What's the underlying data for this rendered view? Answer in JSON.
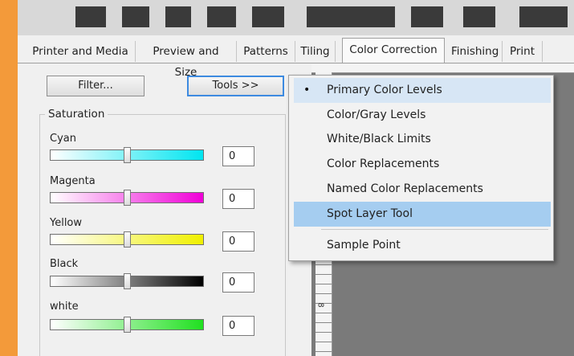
{
  "tabs": [
    {
      "label": "Printer and Media"
    },
    {
      "label": "Preview and Size"
    },
    {
      "label": "Patterns"
    },
    {
      "label": "Tiling"
    },
    {
      "label": "Color Correction"
    },
    {
      "label": "Finishing"
    },
    {
      "label": "Print"
    }
  ],
  "active_tab": "Color Correction",
  "buttons": {
    "filter": "Filter...",
    "tools": "Tools >>"
  },
  "saturation": {
    "title": "Saturation",
    "channels": [
      {
        "label": "Cyan",
        "value": "0",
        "color": "#00e5f0",
        "level": 0.5
      },
      {
        "label": "Magenta",
        "value": "0",
        "color": "#f000d8",
        "level": 0.5
      },
      {
        "label": "Yellow",
        "value": "0",
        "color": "#f0f000",
        "level": 0.5
      },
      {
        "label": "Black",
        "value": "0",
        "color": "#000000",
        "level": 0.5
      },
      {
        "label": "white",
        "value": "0",
        "color": "#20e020",
        "level": 0.5
      }
    ]
  },
  "tools_menu": {
    "items": [
      {
        "label": "Primary Color Levels",
        "checked": true
      },
      {
        "label": "Color/Gray Levels"
      },
      {
        "label": "White/Black Limits"
      },
      {
        "label": "Color Replacements"
      },
      {
        "label": "Named Color Replacements"
      },
      {
        "label": "Spot Layer Tool",
        "highlighted": true
      },
      {
        "label": "Sample Point"
      }
    ],
    "bullet": "•"
  },
  "ruler": {
    "label": "8"
  },
  "colors": {
    "frame_border": "#f39a3a",
    "highlight": "#a5cdf0"
  }
}
